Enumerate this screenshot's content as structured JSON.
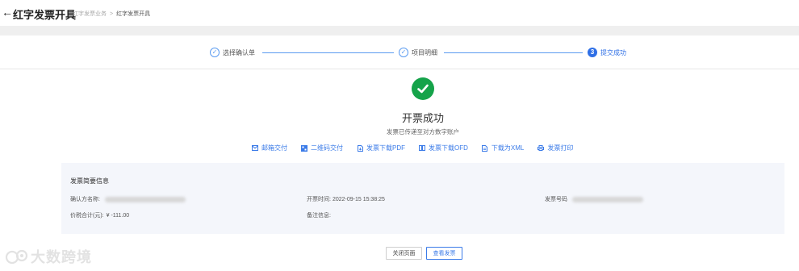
{
  "header": {
    "title": "红字发票开具",
    "breadcrumb": [
      "红字发票业务",
      "红字发票开具"
    ],
    "breadcrumb_separator": ">"
  },
  "steps": [
    {
      "label": "选择确认单",
      "state": "done",
      "icon": "check"
    },
    {
      "label": "项目明细",
      "state": "done",
      "icon": "check"
    },
    {
      "label": "提交成功",
      "state": "active",
      "number": "3"
    }
  ],
  "result": {
    "title": "开票成功",
    "subtitle": "发票已传递至对方数字账户",
    "icon": "success-check-icon",
    "color": "#15a34a"
  },
  "actions": [
    {
      "label": "邮箱交付",
      "icon": "mail-icon"
    },
    {
      "label": "二维码交付",
      "icon": "qrcode-icon"
    },
    {
      "label": "发票下载PDF",
      "icon": "file-download-icon"
    },
    {
      "label": "发票下载OFD",
      "icon": "book-icon"
    },
    {
      "label": "下载为XML",
      "icon": "file-icon"
    },
    {
      "label": "发票打印",
      "icon": "printer-icon"
    }
  ],
  "info": {
    "title": "发票简要信息",
    "confirm_party_label": "确认方名称:",
    "total_label": "价税合计(元):",
    "total_value": "¥ -111.00",
    "issue_time_label": "开票时间:",
    "issue_time_value": "2022-09-15 15:38:25",
    "remark_label": "备注信息:",
    "invoice_no_label": "发票号码"
  },
  "buttons": {
    "close": "关闭页面",
    "view": "查看发票"
  },
  "watermark": {
    "text": "大数跨境"
  },
  "colors": {
    "accent": "#3b7be8",
    "success": "#15a34a",
    "panel_bg": "#f4f6fb"
  }
}
